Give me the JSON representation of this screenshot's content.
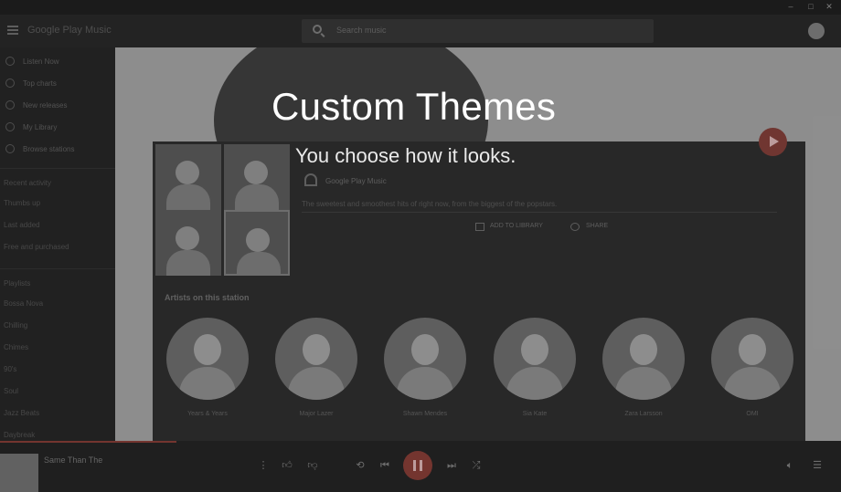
{
  "promo": {
    "title": "Custom Themes",
    "subtitle": "You choose how it looks."
  },
  "header": {
    "app_title": "Google Play Music",
    "search_placeholder": "Search music"
  },
  "sidebar": {
    "items": [
      {
        "label": "Listen Now",
        "icon": "listen-now-icon"
      },
      {
        "label": "Top charts",
        "icon": "chart-icon"
      },
      {
        "label": "New releases",
        "icon": "new-releases-icon"
      },
      {
        "label": "My Library",
        "icon": "library-icon"
      },
      {
        "label": "Browse stations",
        "icon": "radio-icon"
      }
    ],
    "recent_header": "Recent activity",
    "recent": [
      "Thumbs up",
      "Last added",
      "Free and purchased"
    ],
    "playlists_header": "Playlists",
    "playlists": [
      "Bossa Nova",
      "Chilling",
      "Chimes",
      "90's",
      "Soul",
      "Jazz Beats",
      "Daybreak"
    ]
  },
  "card": {
    "source": "Google Play Music",
    "description": "The sweetest and smoothest hits of right now, from the biggest of the popstars.",
    "add_label": "ADD TO LIBRARY",
    "share_label": "SHARE",
    "section_title": "Artists on this station",
    "artists": [
      "Years & Years",
      "Major Lazer",
      "Shawn Mendes",
      "Sia Kate",
      "Zara Larsson",
      "OMI"
    ]
  },
  "player": {
    "track_title": "Same Than The",
    "track_artist": "",
    "accent": "#7e3a34",
    "progress": 0.21
  }
}
